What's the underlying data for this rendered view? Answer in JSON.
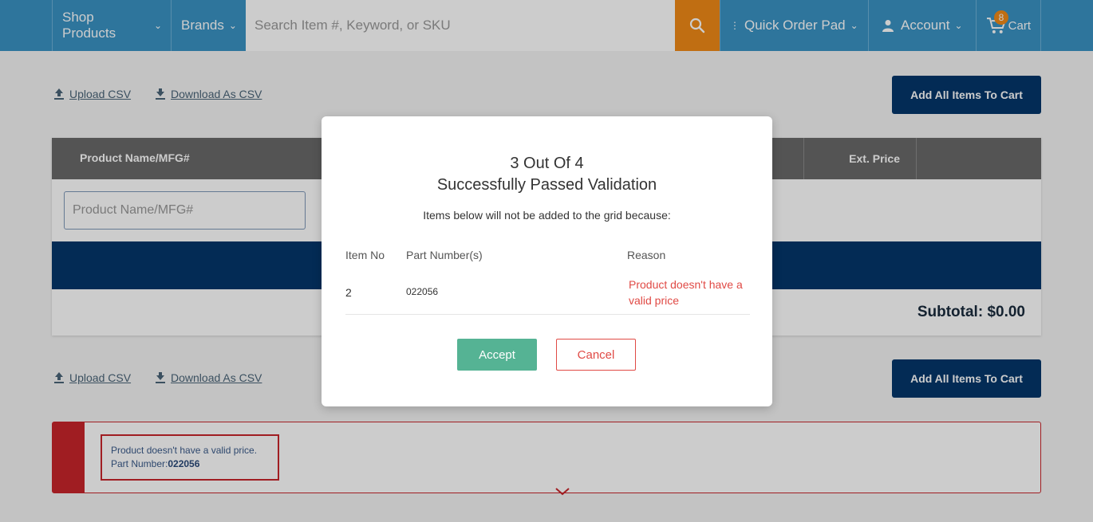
{
  "header": {
    "shop_products": "Shop Products",
    "brands": "Brands",
    "search_placeholder": "Search Item #, Keyword, or SKU",
    "quick_order_pad": "Quick Order Pad",
    "account": "Account",
    "cart": "Cart",
    "cart_count": "8"
  },
  "toolbar": {
    "upload_csv": "Upload CSV",
    "download_csv": "Download As CSV",
    "add_all": "Add All Items To Cart"
  },
  "grid": {
    "col_product": "Product Name/MFG#",
    "col_ext_price": "Ext. Price",
    "input_placeholder": "Product Name/MFG#",
    "subtotal": "Subtotal: $0.00"
  },
  "error_panel": {
    "message": "Product doesn't have a valid price.",
    "part_label": "Part Number:",
    "part_number": "022056"
  },
  "modal": {
    "title_line1": "3 Out Of 4",
    "title_line2": "Successfully Passed Validation",
    "subtitle": "Items below will not be added to the grid because:",
    "columns": {
      "item_no": "Item No",
      "part_numbers": "Part Number(s)",
      "reason": "Reason"
    },
    "rows": [
      {
        "item_no": "2",
        "part_number": "022056",
        "reason": "Product doesn't have a valid price"
      }
    ],
    "accept": "Accept",
    "cancel": "Cancel"
  },
  "colors": {
    "header_blue": "#3a93c4",
    "search_orange": "#f08a17",
    "navy": "#04366b",
    "error_red": "#c8252b",
    "accept_green": "#55b394"
  }
}
